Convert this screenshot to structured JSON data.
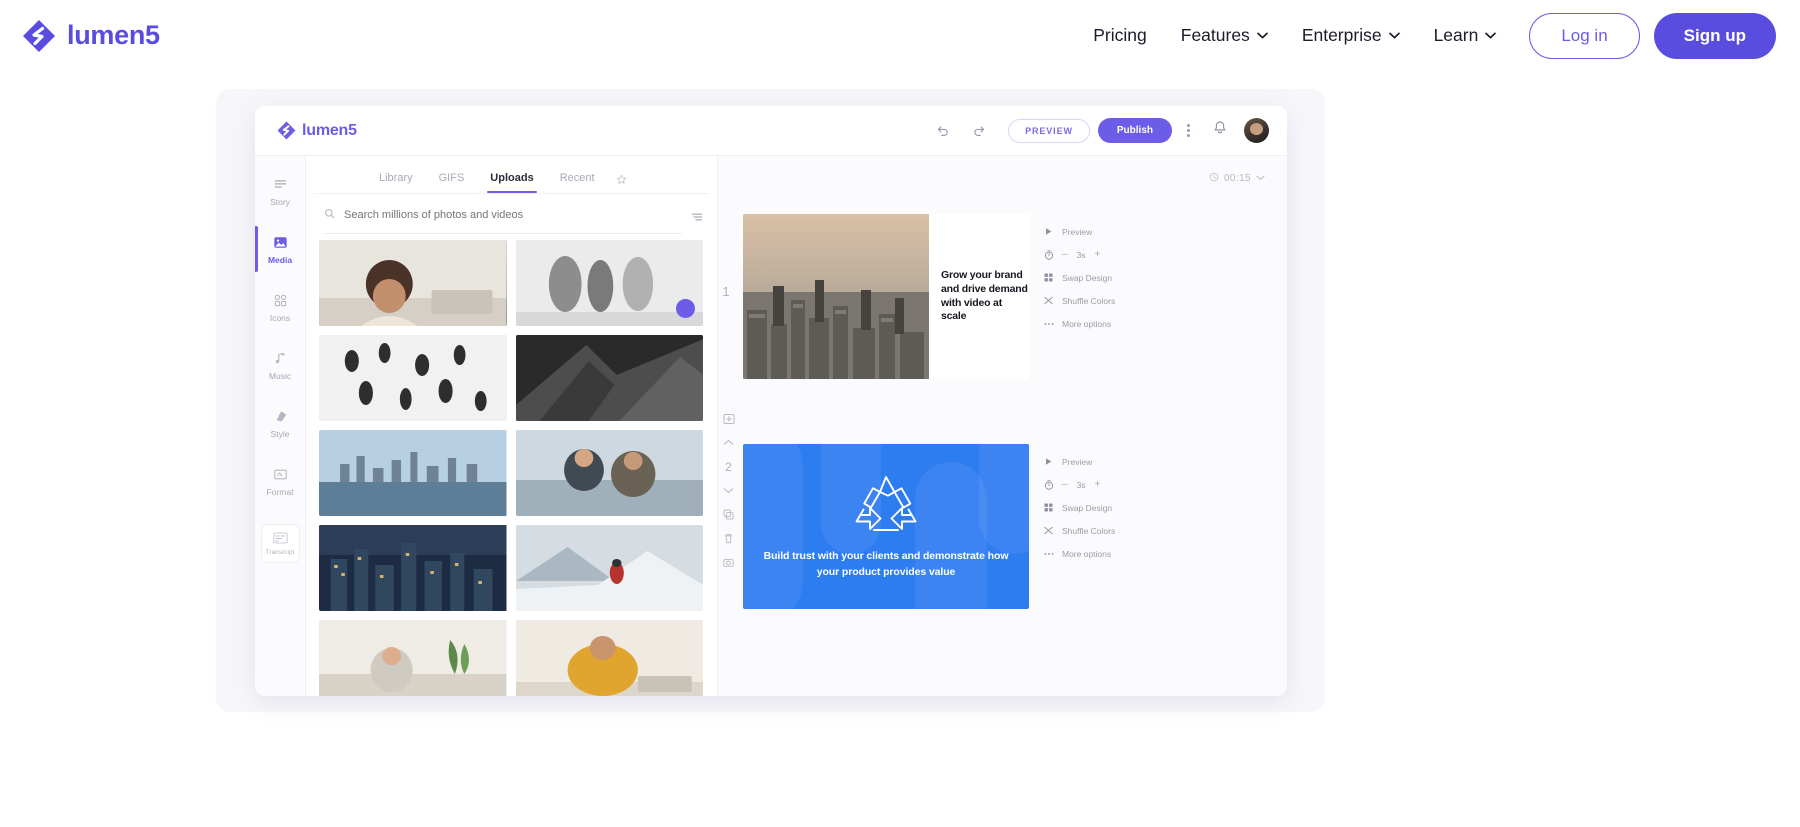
{
  "site": {
    "brand": {
      "name": "lumen5",
      "logo_icon": "lumen5-logo-icon",
      "color": "#5b4ce0"
    },
    "nav": [
      {
        "label": "Pricing",
        "has_caret": false
      },
      {
        "label": "Features",
        "has_caret": true
      },
      {
        "label": "Enterprise",
        "has_caret": true
      },
      {
        "label": "Learn",
        "has_caret": true
      }
    ],
    "login_label": "Log in",
    "signup_label": "Sign up",
    "accent_color": "#5b4ce0"
  },
  "app": {
    "brand": {
      "name": "lumen5",
      "logo_icon": "lumen5-logo-icon"
    },
    "topbar": {
      "undo_icon": "undo-icon",
      "redo_icon": "redo-icon",
      "preview_label": "PREVIEW",
      "publish_label": "Publish",
      "more_icon": "kebab-menu-icon",
      "notifications_icon": "bell-icon",
      "avatar_icon": "user-avatar"
    },
    "rail": {
      "items": [
        {
          "label": "Story",
          "icon": "story-lines-icon",
          "active": false
        },
        {
          "label": "Media",
          "icon": "media-image-icon",
          "active": true
        },
        {
          "label": "Icons",
          "icon": "icons-grid-icon",
          "active": false
        },
        {
          "label": "Music",
          "icon": "music-note-icon",
          "active": false
        },
        {
          "label": "Style",
          "icon": "style-palette-icon",
          "active": false
        },
        {
          "label": "Format",
          "icon": "format-frame-icon",
          "active": false
        }
      ],
      "transcript": {
        "label": "Transcript",
        "icon": "transcript-icon"
      }
    },
    "media_panel": {
      "tabs": [
        {
          "label": "Library",
          "active": false
        },
        {
          "label": "GIFS",
          "active": false
        },
        {
          "label": "Uploads",
          "active": true
        },
        {
          "label": "Recent",
          "active": false
        }
      ],
      "favorites_icon": "star-icon",
      "search": {
        "icon": "search-icon",
        "placeholder": "Search millions of photos and videos",
        "value": ""
      },
      "filter_icon": "filter-sliders-icon",
      "thumbnails": [
        {
          "name": "woman-at-laptop-smiling"
        },
        {
          "name": "blurred-people-walking-bw",
          "badge": true
        },
        {
          "name": "crowd-silhouettes-bw"
        },
        {
          "name": "glass-building-facade-bw"
        },
        {
          "name": "city-skyline-water"
        },
        {
          "name": "two-people-talking-outdoors"
        },
        {
          "name": "city-skyline-at-dusk"
        },
        {
          "name": "person-in-red-jacket-snow"
        },
        {
          "name": "woman-on-couch-with-plant"
        },
        {
          "name": "person-in-yellow-sweater-desk"
        }
      ]
    },
    "canvas": {
      "timecode": "00:15",
      "timecode_icon": "clock-icon",
      "chevron_icon": "chevron-down-icon",
      "side_tools": [
        {
          "icon": "add-scene-icon"
        },
        {
          "icon": "move-up-icon"
        },
        {
          "icon": "move-down-icon"
        },
        {
          "icon": "duplicate-icon"
        },
        {
          "icon": "delete-icon"
        },
        {
          "icon": "camera-icon"
        }
      ],
      "scenes": [
        {
          "number": "1",
          "visual": "aerial-city-photo",
          "text": "Grow your brand and drive demand with video at scale",
          "options": [
            {
              "label": "Preview",
              "icon": "play-icon"
            },
            {
              "label": "3s",
              "icon": "timer-icon",
              "minus": "–",
              "plus": "+"
            },
            {
              "label": "Swap Design",
              "icon": "grid-squares-icon"
            },
            {
              "label": "Shuffle Colors",
              "icon": "shuffle-icon"
            },
            {
              "label": "More options",
              "icon": "ellipsis-icon"
            }
          ]
        },
        {
          "number": "2",
          "visual": "recycle-symbol-blue",
          "text": "Build trust with your clients and demonstrate how your product provides value",
          "options": [
            {
              "label": "Preview",
              "icon": "play-icon"
            },
            {
              "label": "3s",
              "icon": "timer-icon",
              "minus": "–",
              "plus": "+"
            },
            {
              "label": "Swap Design",
              "icon": "grid-squares-icon"
            },
            {
              "label": "Shuffle Colors",
              "icon": "shuffle-icon"
            },
            {
              "label": "More options",
              "icon": "ellipsis-icon"
            }
          ]
        }
      ]
    }
  }
}
